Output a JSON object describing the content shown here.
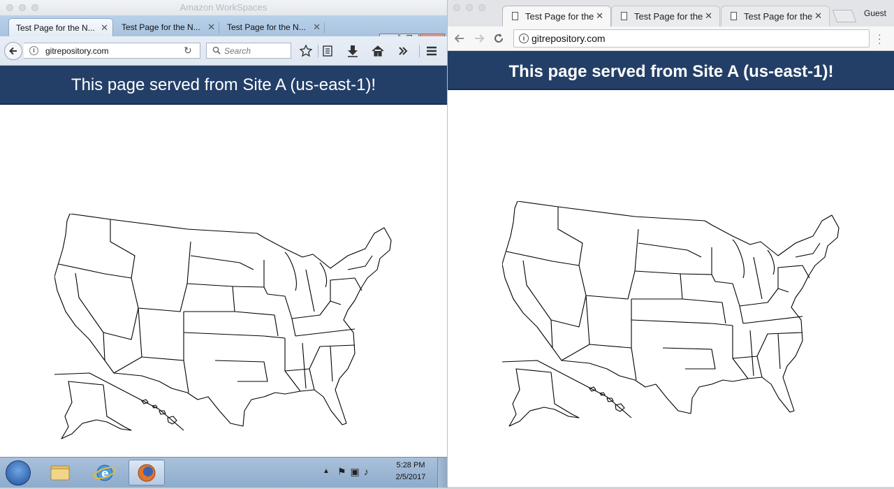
{
  "left_window": {
    "title": "Amazon WorkSpaces",
    "firefox": {
      "tabs": [
        {
          "label": "Test Page for the N...",
          "active": true
        },
        {
          "label": "Test Page for the N...",
          "active": false
        },
        {
          "label": "Test Page for the N...",
          "active": false
        }
      ],
      "new_tab_label": "+",
      "url": "gitrepository.com",
      "search_placeholder": "Search",
      "page_heading": "This page served from Site A (us-east-1)!"
    },
    "taskbar": {
      "time": "5:28 PM",
      "date": "2/5/2017",
      "apps": [
        "windows-explorer",
        "internet-explorer",
        "firefox"
      ]
    }
  },
  "right_window": {
    "chrome": {
      "tabs": [
        {
          "label": "Test Page for the",
          "active": true
        },
        {
          "label": "Test Page for the",
          "active": false
        },
        {
          "label": "Test Page for the",
          "active": false
        }
      ],
      "profile_label": "Guest",
      "url": "gitrepository.com",
      "page_heading": "This page served from Site A (us-east-1)!"
    }
  },
  "colors": {
    "page_header_bg": "#233f67",
    "page_header_text": "#ffffff",
    "firefox_tabstrip": "#b9d1ea",
    "taskbar": "#9bb4d1"
  },
  "icons": [
    "back-icon",
    "info-icon",
    "reload-icon",
    "search-icon",
    "bookmark-star-icon",
    "reading-list-icon",
    "download-icon",
    "home-icon",
    "overflow-icon",
    "hamburger-menu-icon",
    "close-icon",
    "new-tab-icon",
    "forward-icon",
    "more-vert-icon",
    "document-icon",
    "start-orb-icon",
    "flag-icon",
    "network-icon",
    "volume-icon"
  ]
}
